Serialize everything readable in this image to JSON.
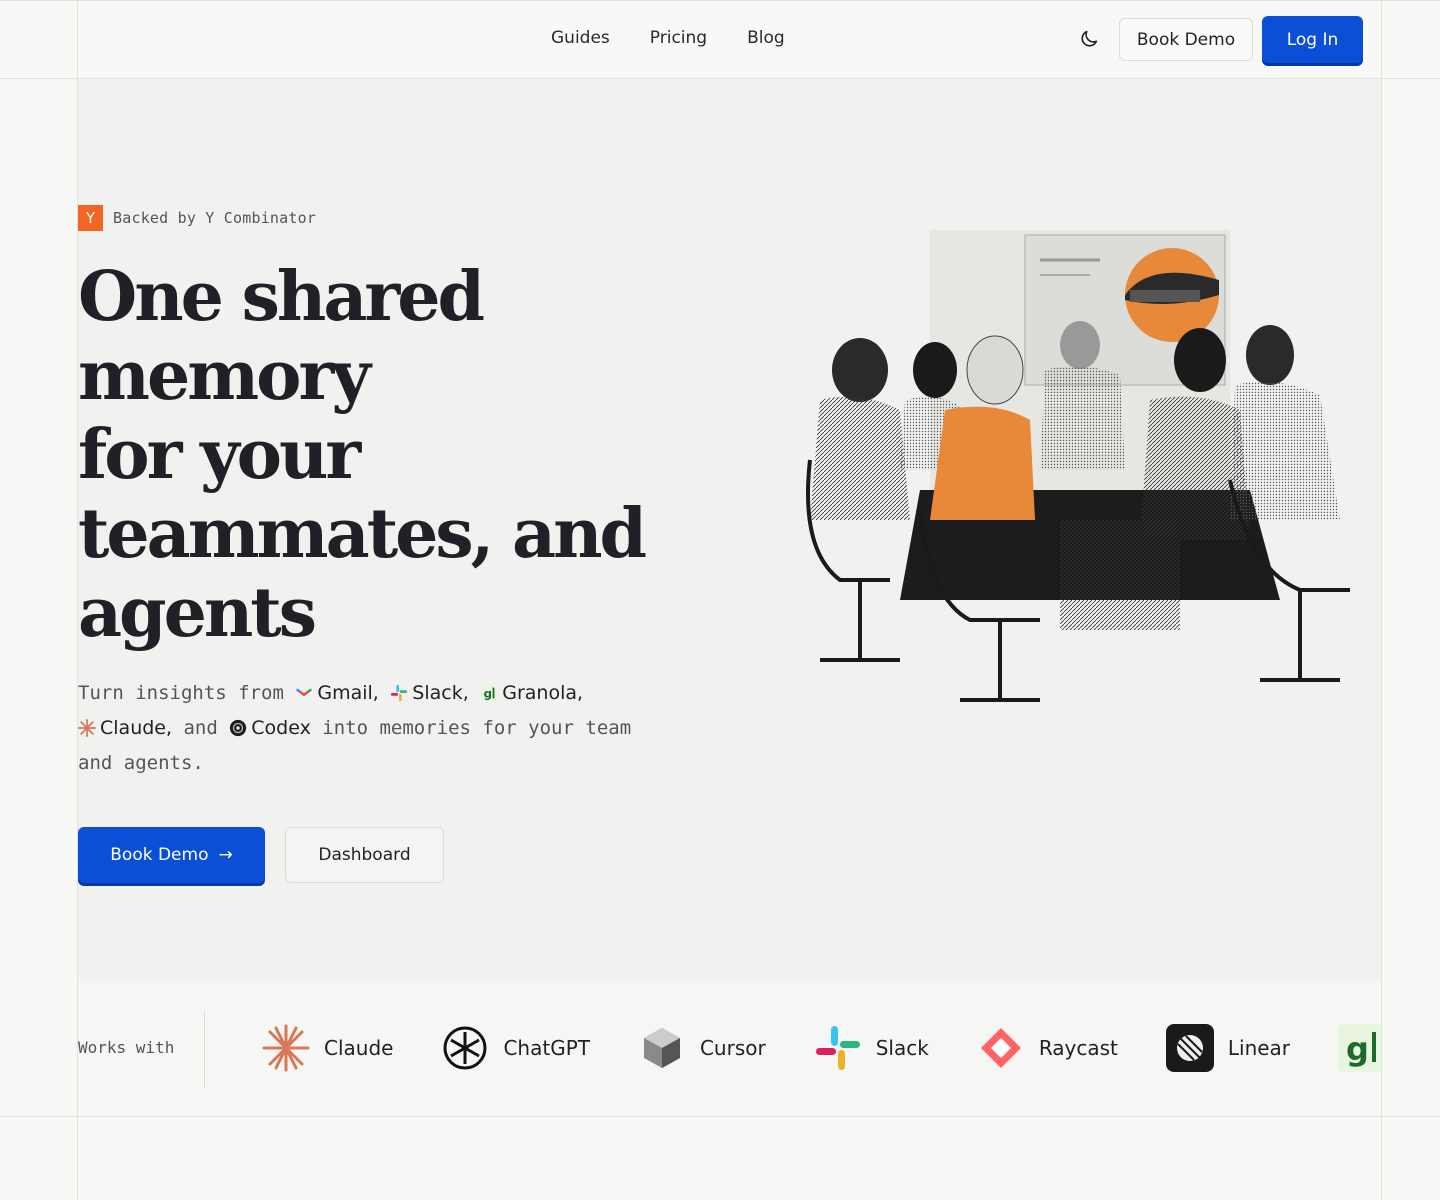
{
  "nav": {
    "items": [
      "Guides",
      "Pricing",
      "Blog"
    ]
  },
  "header": {
    "book_demo": "Book Demo",
    "login": "Log In"
  },
  "hero": {
    "badge_letter": "Y",
    "badge_text": "Backed by Y Combinator",
    "headline_lines": [
      "One shared",
      "memory",
      "for your",
      "teammates, and",
      "agents"
    ],
    "sub": {
      "prefix": "Turn insights from",
      "gmail": "Gmail,",
      "slack": "Slack,",
      "granola": "Granola,",
      "claude": "Claude,",
      "and": "and",
      "codex": "Codex",
      "suffix": "into memories for your team and agents."
    },
    "cta_primary": "Book Demo",
    "cta_arrow": "→",
    "cta_secondary": "Dashboard"
  },
  "works_with": {
    "label": "Works with",
    "logos": [
      "Claude",
      "ChatGPT",
      "Cursor",
      "Slack",
      "Raycast",
      "Linear"
    ]
  },
  "colors": {
    "accent": "#0a4fd6",
    "yc": "#f26522",
    "highlight": "#e8893a"
  }
}
